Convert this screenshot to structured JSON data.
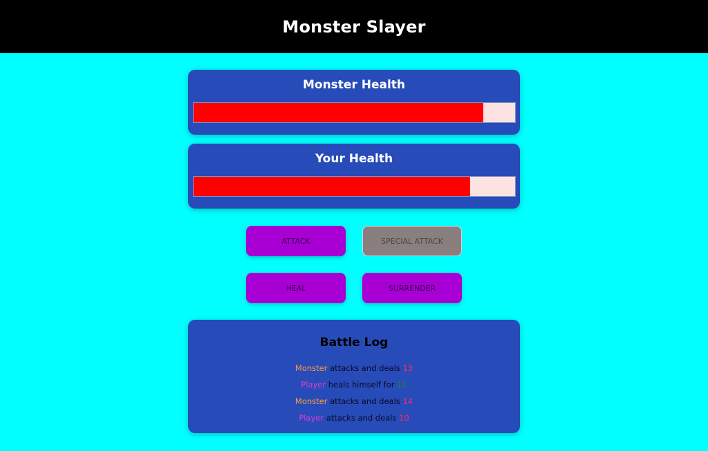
{
  "header": {
    "title": "Monster Slayer"
  },
  "monster": {
    "heading": "Monster Health",
    "health_percent": 90
  },
  "player": {
    "heading": "Your Health",
    "health_percent": 86
  },
  "controls": {
    "attack_label": "ATTACK",
    "special_attack_label": "SPECIAL ATTACK",
    "heal_label": "HEAL",
    "surrender_label": "SURRENDER"
  },
  "battle_log": {
    "heading": "Battle Log",
    "entries": [
      {
        "actor": "Monster",
        "text": " attacks and deals ",
        "value": "13"
      },
      {
        "actor": "Player",
        "text": " heals himself for ",
        "value": "12"
      },
      {
        "actor": "Monster",
        "text": " attacks and deals ",
        "value": "14"
      },
      {
        "actor": "Player",
        "text": " attacks and deals ",
        "value": "10"
      }
    ]
  },
  "colors": {
    "background": "#00ffff",
    "header": "#000000",
    "panel": "#274bb8",
    "health_fill": "#ff0000",
    "health_track": "#fde2e2",
    "button": "#a800d4",
    "button_disabled": "#8a7f7f",
    "monster_name": "#ff9a3d",
    "player_name": "#e23ad0",
    "damage_value": "#ff2a6a",
    "heal_value": "#1e8a2a"
  }
}
